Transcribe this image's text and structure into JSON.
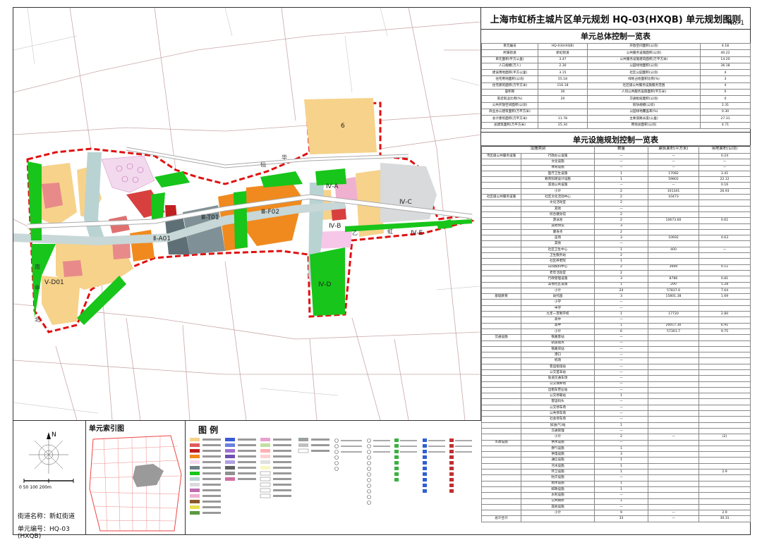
{
  "document": {
    "title": "上海市虹桥主城片区单元规划  HQ-03(HXQB) 单元规划图则",
    "number": "No. 1"
  },
  "overview_table": {
    "title": "单元总体控制一览表",
    "rows": [
      [
        "单元编号",
        "HQ-03(HXQB)",
        "开放空间面积(公顷)",
        "4.18"
      ],
      [
        "所属街道",
        "新虹街道",
        "公共服务设施面积(公顷)",
        "40.22"
      ],
      [
        "单元面积(平方公里)",
        "3.47",
        "公共服务设施建筑面积(万平方米)",
        "14.20"
      ],
      [
        "人口规模(万人)",
        "2.30",
        "公园绿地面积(公顷)",
        "36.18"
      ],
      [
        "建设用地面积(平方公里)",
        "3.15",
        "社区公园面积(公顷)",
        "4"
      ],
      [
        "住宅用地面积(公顷)",
        "55.18",
        "绿地占地面积比例(%)",
        "3"
      ],
      [
        "住宅建筑面积(万平方米)",
        "116.18",
        "社区级公共服务设施服务范围",
        "4"
      ],
      [
        "容积率",
        "30",
        "人均公共服务设施面积(平方米)",
        "0"
      ],
      [
        "就近就业比例(%)",
        "20",
        "交通枢纽面积(公顷)",
        "0"
      ],
      [
        "公共开放空间面积(公顷)",
        "",
        "街坊规模(公顷)",
        "2.31"
      ],
      [
        "商业办公建筑面积(万平方米)",
        "",
        "公园绿地覆盖率(%)",
        "0.30"
      ],
      [
        "总计建筑面积(万平方米)",
        "11.78",
        "主要道路长度(公里)",
        "27.31"
      ],
      [
        "总建筑面积(万平方米)",
        "25.34",
        "用地总面积(公顷)",
        "4.71"
      ]
    ]
  },
  "facility_table": {
    "title": "单元设施规划控制一览表",
    "headers": [
      "设施类别",
      "",
      "",
      "数量",
      "建筑面积(平方米)",
      "用地面积(公顷)"
    ],
    "rows": [
      [
        "市区级公共服务设施",
        "行政办公设施",
        "—",
        "—",
        "0.24"
      ],
      [
        "",
        "文化设施",
        "—",
        "—",
        "—"
      ],
      [
        "",
        "体育设施",
        "—",
        "—",
        "—"
      ],
      [
        "",
        "医疗卫生设施",
        "1",
        "17082",
        "3.41"
      ],
      [
        "",
        "教育科研设计设施",
        "1",
        "59802",
        "22.12"
      ],
      [
        "",
        "其他公共设施",
        "—",
        "—",
        "0.16"
      ],
      [
        "",
        "小计",
        "2",
        "101341",
        "26.93"
      ],
      [
        "社区级公共服务设施",
        "社区文化活动中心",
        "2",
        "10473",
        ""
      ],
      [
        "",
        "文化活动室",
        "2",
        "",
        ""
      ],
      [
        "",
        "其他",
        "—",
        "",
        ""
      ],
      [
        "",
        "综合健身馆",
        "2",
        "",
        ""
      ],
      [
        "",
        "游泳池",
        "2",
        "10673.60",
        "0.61"
      ],
      [
        "",
        "其他场馆",
        "3",
        "",
        ""
      ],
      [
        "",
        "健身点",
        "2",
        "",
        ""
      ],
      [
        "",
        "菜场",
        "3",
        "10692",
        "0.63"
      ],
      [
        "",
        "其他",
        "—",
        "",
        ""
      ],
      [
        "",
        "社区卫生中心",
        "1",
        "400",
        "—"
      ],
      [
        "",
        "卫生服务站",
        "2",
        "",
        ""
      ],
      [
        "",
        "社区养老院",
        "1",
        "",
        ""
      ],
      [
        "",
        "日间照料中心",
        "2",
        "3600",
        "0.11"
      ],
      [
        "",
        "老年活动室",
        "2",
        "",
        ""
      ],
      [
        "",
        "行政管理设施",
        "3",
        "8786",
        "0.81"
      ],
      [
        "",
        "其他社区设施",
        "1",
        "200",
        "5.28"
      ],
      [
        "",
        "小计",
        "24",
        "57837.6",
        "7.64"
      ],
      [
        "基础教育",
        "幼托园",
        "3",
        "15801.38",
        "1.69"
      ],
      [
        "",
        "小学",
        "—",
        "",
        ""
      ],
      [
        "",
        "中学",
        "—",
        "",
        ""
      ],
      [
        "",
        "九年一贯制学校",
        "1",
        "17720",
        "2.80"
      ],
      [
        "",
        "高中",
        "—",
        "",
        ""
      ],
      [
        "",
        "高中",
        "1",
        "20017.30",
        "6.91"
      ],
      [
        "",
        "小计",
        "6",
        "57301.7",
        "9.75"
      ],
      [
        "交通设施",
        "铁路客站",
        "—",
        "",
        ""
      ],
      [
        "",
        "轨道站点",
        "—",
        "",
        ""
      ],
      [
        "",
        "铁路货站",
        "—",
        "",
        ""
      ],
      [
        "",
        "港口",
        "—",
        "",
        ""
      ],
      [
        "",
        "机场",
        "—",
        "",
        ""
      ],
      [
        "",
        "客运枢纽站",
        "—",
        "",
        ""
      ],
      [
        "",
        "公交首末站",
        "—",
        "",
        ""
      ],
      [
        "",
        "轨道交通车场",
        "—",
        "",
        ""
      ],
      [
        "",
        "公交保养场",
        "—",
        "",
        ""
      ],
      [
        "",
        "出租车营业站",
        "—",
        "",
        ""
      ],
      [
        "",
        "公交停靠站",
        "1",
        "",
        ""
      ],
      [
        "",
        "客运码头",
        "—",
        "",
        ""
      ],
      [
        "",
        "公交停车场",
        "—",
        "",
        ""
      ],
      [
        "",
        "公共停车场",
        "—",
        "",
        ""
      ],
      [
        "",
        "社会停车场",
        "—",
        "",
        ""
      ],
      [
        "",
        "加油(气)站",
        "1",
        "",
        ""
      ],
      [
        "",
        "交通管理",
        "—",
        "",
        ""
      ],
      [
        "",
        "小计",
        "2",
        "—",
        "(2)"
      ],
      [
        "市政设施",
        "供水设施",
        "—",
        "",
        ""
      ],
      [
        "",
        "燃气设施",
        "1",
        "",
        ""
      ],
      [
        "",
        "供电设施",
        "3",
        "",
        ""
      ],
      [
        "",
        "通信设施",
        "1",
        "",
        ""
      ],
      [
        "",
        "污水设施",
        "1",
        "",
        ""
      ],
      [
        "",
        "环卫设施",
        "1",
        "",
        "2.9"
      ],
      [
        "",
        "防灾设施",
        "—",
        "",
        ""
      ],
      [
        "",
        "雨水设施",
        "1",
        "",
        ""
      ],
      [
        "",
        "邮政设施",
        "1",
        "",
        ""
      ],
      [
        "",
        "水利设施",
        "—",
        "",
        ""
      ],
      [
        "",
        "公共厕所",
        "1",
        "",
        ""
      ],
      [
        "",
        "其他设施",
        "—",
        "",
        ""
      ],
      [
        "",
        "小计",
        "9",
        "—",
        "2.9"
      ],
      [
        "总计合计",
        "",
        "33",
        "—",
        "30.31"
      ]
    ]
  },
  "map": {
    "zones": [
      "Ⅰ-06",
      "Ⅱ-A01",
      "Ⅲ-T01",
      "Ⅲ-F02",
      "Ⅳ-A",
      "Ⅳ-B",
      "Ⅳ-C",
      "Ⅳ-D",
      "Ⅳ-E",
      "Ⅴ-D01"
    ],
    "roads": [
      "南",
      "申",
      "仙",
      "华",
      "虹",
      "乙",
      "北"
    ],
    "scale_label": "0   50   100   200m"
  },
  "compass": {
    "north": "N"
  },
  "info": {
    "street": "街道名称：新虹街道",
    "unit_no": "单元编号：HQ-03 (HXQB)"
  },
  "index_map": {
    "title": "单元索引图"
  },
  "legend": {
    "title": "图  例"
  },
  "colors": {
    "residential": "#f6d28a",
    "commercial": "#f08a1e",
    "public": "#e05b5b",
    "green": "#18c51a",
    "water": "#b9d3d3",
    "industrial": "#6b7f86",
    "boundary": "#e01010"
  }
}
